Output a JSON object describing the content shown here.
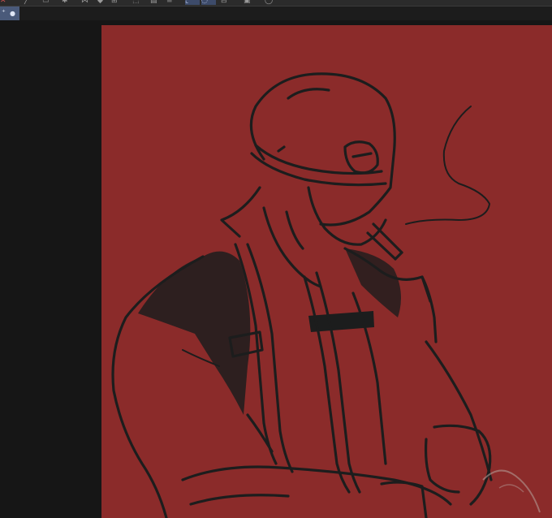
{
  "app": {
    "accent_color": "#4a5a7a",
    "workspace_color": "#161616"
  },
  "toolbar": {
    "tools": [
      {
        "icon": "close-icon"
      },
      {
        "icon": "line-tool-icon"
      },
      {
        "icon": "ruler-icon"
      },
      {
        "icon": "symmetry-icon"
      },
      {
        "icon": "mirror-icon"
      },
      {
        "icon": "fill-icon"
      },
      {
        "icon": "transform-icon"
      },
      {
        "icon": "selection-icon"
      },
      {
        "icon": "layer-icon"
      },
      {
        "icon": "layer-stack-icon"
      },
      {
        "icon": "select-rect-icon"
      },
      {
        "icon": "select-lasso-icon"
      },
      {
        "icon": "flip-icon"
      },
      {
        "icon": "save-icon"
      },
      {
        "icon": "speech-icon"
      }
    ]
  },
  "document_tab": {
    "modified_marker": "●",
    "pin_glyph": "⁺"
  },
  "canvas": {
    "background_color": "#8b2b2a",
    "line_color": "#1c1d1d",
    "smoke_color": "#b39a95"
  }
}
